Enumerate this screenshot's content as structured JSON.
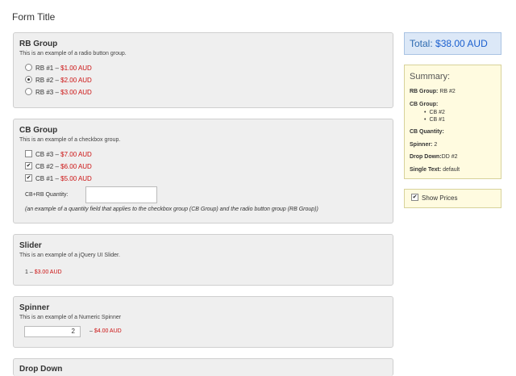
{
  "form_title": "Form Title",
  "rb_group": {
    "title": "RB Group",
    "description": "This is an example of a radio button group.",
    "options": [
      {
        "label": "RB #1",
        "price": "$1.00 AUD",
        "checked": false
      },
      {
        "label": "RB #2",
        "price": "$2.00 AUD",
        "checked": true
      },
      {
        "label": "RB #3",
        "price": "$3.00 AUD",
        "checked": false
      }
    ]
  },
  "cb_group": {
    "title": "CB Group",
    "description": "This is an example of a checkbox group.",
    "options": [
      {
        "label": "CB #3",
        "price": "$7.00 AUD",
        "checked": false
      },
      {
        "label": "CB #2",
        "price": "$6.00 AUD",
        "checked": true
      },
      {
        "label": "CB #1",
        "price": "$5.00 AUD",
        "checked": true
      }
    ],
    "quantity_label": "CB+RB Quantity:",
    "quantity_value": "",
    "note": "(an example of a quantity field that applies to the checkbox group (CB Group) and the radio button group (RB Group))"
  },
  "slider": {
    "title": "Slider",
    "description": "This is an example of a jQuery UI Slider.",
    "value": "1",
    "price": "$3.00 AUD"
  },
  "spinner": {
    "title": "Spinner",
    "description": "This is an example of a Numeric Spinner",
    "value": "2",
    "price": "$4.00 AUD"
  },
  "drop_down": {
    "title": "Drop Down"
  },
  "total": {
    "label": "Total:",
    "amount": "$38.00 AUD"
  },
  "summary": {
    "heading": "Summary:",
    "rb_group_label": "RB Group:",
    "rb_group_value": "RB #2",
    "cb_group_label": "CB Group:",
    "cb_group_items": [
      "CB #2",
      "CB #1"
    ],
    "cb_quantity_label": "CB Quantity:",
    "spinner_label": "Spinner:",
    "spinner_value": "2",
    "drop_down_label": "Drop Down:",
    "drop_down_value": "DD #2",
    "single_text_label": "Single Text:",
    "single_text_value": "default"
  },
  "show_prices": {
    "label": "Show Prices",
    "checked": true
  },
  "colors": {
    "price": "#cc1111",
    "total_text": "#1a5fcf",
    "total_bg": "#dce8f7",
    "summary_bg": "#fffbe0"
  }
}
